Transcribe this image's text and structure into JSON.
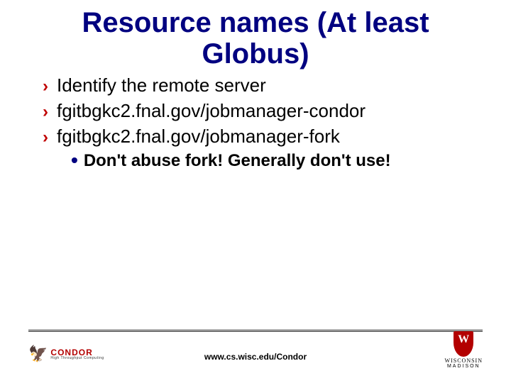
{
  "title_line1": "Resource names (At least",
  "title_line2": "Globus)",
  "bullets": {
    "b1": "Identify the remote server",
    "b2": "fgitbgkc2.fnal.gov/jobmanager-condor",
    "b3": "fgitbgkc2.fnal.gov/jobmanager-fork",
    "sub": "Don't abuse fork! Generally don't use!"
  },
  "footer_url": "www.cs.wisc.edu/Condor",
  "logo_left": {
    "brand": "CONDOR",
    "sub": "High Throughput Computing"
  },
  "logo_right": {
    "uw": "WISCONSIN",
    "madison": "MADISON"
  }
}
